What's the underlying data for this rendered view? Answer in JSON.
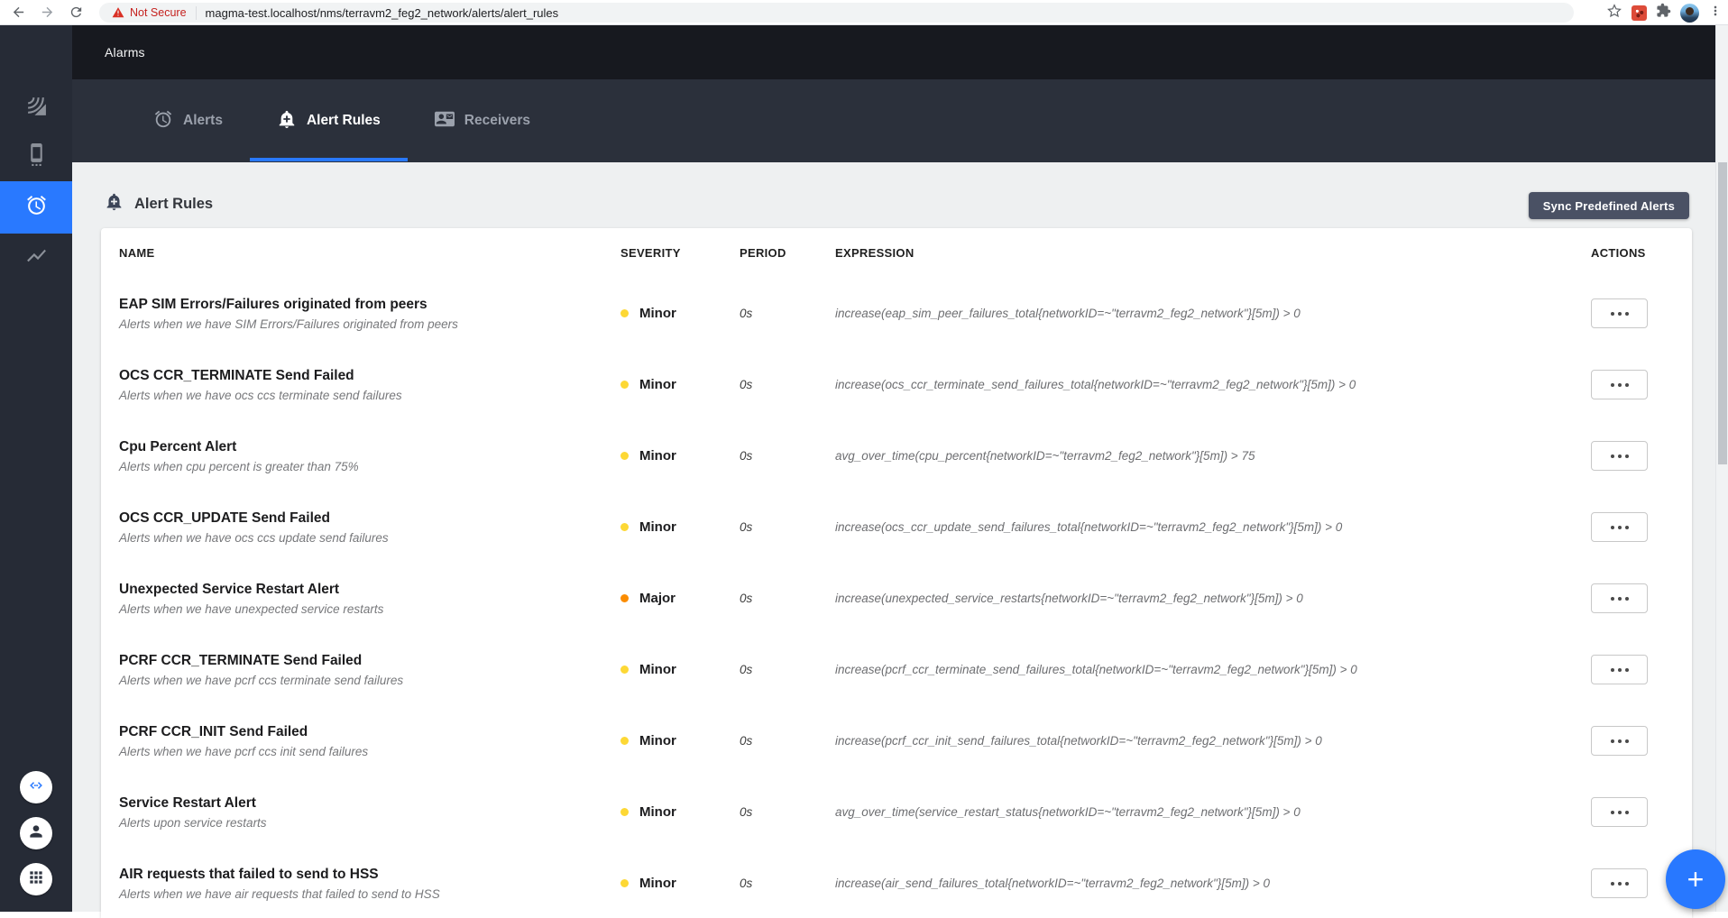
{
  "browser": {
    "security_label": "Not Secure",
    "url": "magma-test.localhost/nms/terravm2_feg2_network/alerts/alert_rules"
  },
  "appbar": {
    "title": "Alarms"
  },
  "tabs": {
    "alerts": "Alerts",
    "alert_rules": "Alert Rules",
    "receivers": "Receivers"
  },
  "sidebar": {
    "top_icons": [
      "cell-wifi",
      "settings-cell",
      "alarm-clock",
      "metrics-chart"
    ],
    "active_icon": "alarm-clock",
    "bottom_icons": [
      "api-code",
      "account",
      "apps-grid"
    ]
  },
  "section": {
    "title": "Alert Rules",
    "sync_button": "Sync Predefined Alerts"
  },
  "table": {
    "columns": [
      "NAME",
      "SEVERITY",
      "PERIOD",
      "EXPRESSION",
      "ACTIONS"
    ],
    "rows": [
      {
        "name": "EAP SIM Errors/Failures originated from peers",
        "description": "Alerts when we have SIM Errors/Failures originated from peers",
        "severity": "Minor",
        "period": "0s",
        "expression": "increase(eap_sim_peer_failures_total{networkID=~\"terravm2_feg2_network\"}[5m]) > 0"
      },
      {
        "name": "OCS CCR_TERMINATE Send Failed",
        "description": "Alerts when we have ocs ccs terminate send failures",
        "severity": "Minor",
        "period": "0s",
        "expression": "increase(ocs_ccr_terminate_send_failures_total{networkID=~\"terravm2_feg2_network\"}[5m]) > 0"
      },
      {
        "name": "Cpu Percent Alert",
        "description": "Alerts when cpu percent is greater than 75%",
        "severity": "Minor",
        "period": "0s",
        "expression": "avg_over_time(cpu_percent{networkID=~\"terravm2_feg2_network\"}[5m]) > 75"
      },
      {
        "name": "OCS CCR_UPDATE Send Failed",
        "description": "Alerts when we have ocs ccs update send failures",
        "severity": "Minor",
        "period": "0s",
        "expression": "increase(ocs_ccr_update_send_failures_total{networkID=~\"terravm2_feg2_network\"}[5m]) > 0"
      },
      {
        "name": "Unexpected Service Restart Alert",
        "description": "Alerts when we have unexpected service restarts",
        "severity": "Major",
        "period": "0s",
        "expression": "increase(unexpected_service_restarts{networkID=~\"terravm2_feg2_network\"}[5m]) > 0"
      },
      {
        "name": "PCRF CCR_TERMINATE Send Failed",
        "description": "Alerts when we have pcrf ccs terminate send failures",
        "severity": "Minor",
        "period": "0s",
        "expression": "increase(pcrf_ccr_terminate_send_failures_total{networkID=~\"terravm2_feg2_network\"}[5m]) > 0"
      },
      {
        "name": "PCRF CCR_INIT Send Failed",
        "description": "Alerts when we have pcrf ccs init send failures",
        "severity": "Minor",
        "period": "0s",
        "expression": "increase(pcrf_ccr_init_send_failures_total{networkID=~\"terravm2_feg2_network\"}[5m]) > 0"
      },
      {
        "name": "Service Restart Alert",
        "description": "Alerts upon service restarts",
        "severity": "Minor",
        "period": "0s",
        "expression": "avg_over_time(service_restart_status{networkID=~\"terravm2_feg2_network\"}[5m]) > 0"
      },
      {
        "name": "AIR requests that failed to send to HSS",
        "description": "Alerts when we have air requests that failed to send to HSS",
        "severity": "Minor",
        "period": "0s",
        "expression": "increase(air_send_failures_total{networkID=~\"terravm2_feg2_network\"}[5m]) > 0"
      }
    ]
  },
  "severity_colors": {
    "Minor": "#fdd835",
    "Major": "#fb8c00"
  },
  "colors": {
    "accent_blue": "#2979ff",
    "sync_button_bg": "#4a5164",
    "appbar_bg": "#17191f",
    "tabbar_bg": "#2b303b",
    "sidebar_bg": "#262b36",
    "not_secure_red": "#c5221f"
  },
  "fab": {
    "plus": "+"
  }
}
